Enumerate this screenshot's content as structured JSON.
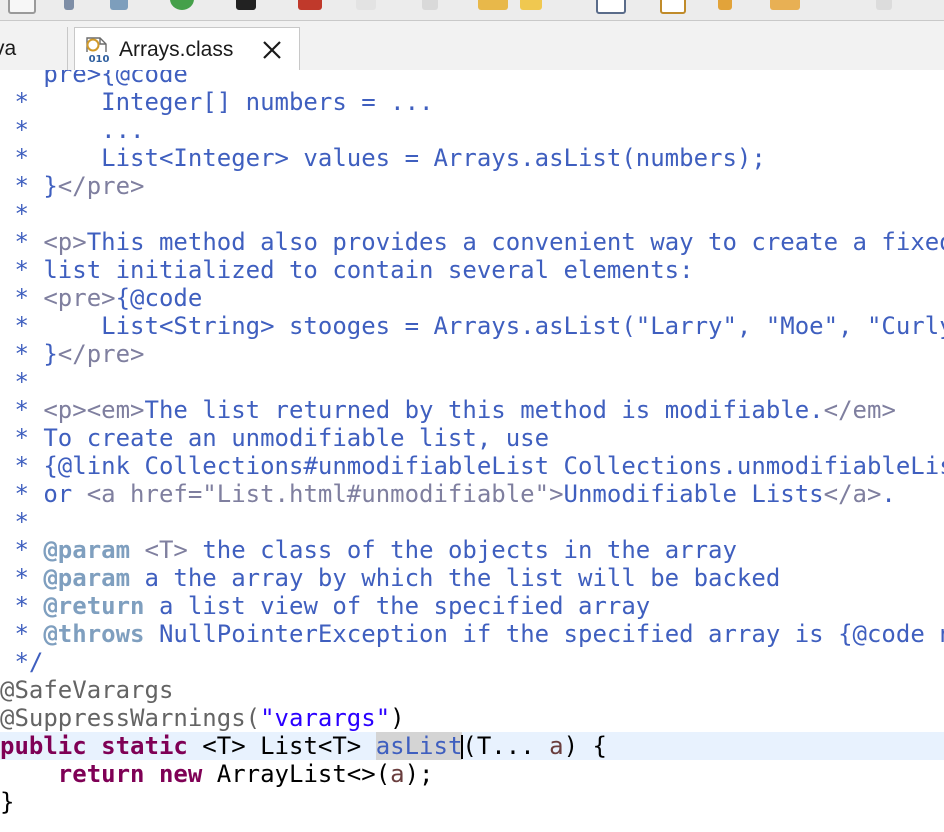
{
  "tabs": {
    "previous_label": "va",
    "active_label": "Arrays.class",
    "active_icon": "class-file-icon",
    "close_icon": "close-icon"
  },
  "toolbar": {
    "icons": [
      "toolbar-icon",
      "toolbar-icon",
      "toolbar-icon",
      "run-icon",
      "toolbar-icon",
      "toolbar-icon",
      "toolbar-icon",
      "toolbar-icon",
      "toolbar-icon",
      "toolbar-icon",
      "toolbar-icon",
      "toolbar-icon",
      "toolbar-icon",
      "toolbar-icon",
      "toolbar-icon"
    ]
  },
  "colors": {
    "javadoc": "#3f5fbf",
    "javadoc_tag": "#7f9fbf",
    "html_tag": "#7f7f9f",
    "keyword": "#7f0055",
    "string": "#2a00ff",
    "annotation": "#646464",
    "current_line": "#e8f2fe"
  },
  "code_lines": [
    [
      {
        "t": "   pre>{@code",
        "c": "c"
      }
    ],
    [
      {
        "t": " *     Integer[] numbers = ...",
        "c": "c"
      }
    ],
    [
      {
        "t": " *     ...",
        "c": "c"
      }
    ],
    [
      {
        "t": " *     List<Integer> values = Arrays.asList(numbers);",
        "c": "c"
      }
    ],
    [
      {
        "t": " * }",
        "c": "c"
      },
      {
        "t": "</pre>",
        "c": "tag"
      }
    ],
    [
      {
        "t": " *",
        "c": "c"
      }
    ],
    [
      {
        "t": " * ",
        "c": "c"
      },
      {
        "t": "<p>",
        "c": "tag"
      },
      {
        "t": "This method also provides a convenient way to create a fixed-size",
        "c": "c"
      }
    ],
    [
      {
        "t": " * list initialized to contain several elements:",
        "c": "c"
      }
    ],
    [
      {
        "t": " * ",
        "c": "c"
      },
      {
        "t": "<pre>",
        "c": "tag"
      },
      {
        "t": "{@code",
        "c": "c"
      }
    ],
    [
      {
        "t": " *     List<String> stooges = Arrays.asList(\"Larry\", \"Moe\", \"Curly\");",
        "c": "c"
      }
    ],
    [
      {
        "t": " * }",
        "c": "c"
      },
      {
        "t": "</pre>",
        "c": "tag"
      }
    ],
    [
      {
        "t": " *",
        "c": "c"
      }
    ],
    [
      {
        "t": " * ",
        "c": "c"
      },
      {
        "t": "<p><em>",
        "c": "tag"
      },
      {
        "t": "The list returned by this method is modifiable.",
        "c": "c"
      },
      {
        "t": "</em>",
        "c": "tag"
      }
    ],
    [
      {
        "t": " * To create an unmodifiable list, use",
        "c": "c"
      }
    ],
    [
      {
        "t": " * {@link Collections#unmodifiableList Collections.unmodifiableList}",
        "c": "c"
      }
    ],
    [
      {
        "t": " * or ",
        "c": "c"
      },
      {
        "t": "<a href=\"List.html#unmodifiable\">",
        "c": "tag"
      },
      {
        "t": "Unmodifiable Lists",
        "c": "c"
      },
      {
        "t": "</a>",
        "c": "tag"
      },
      {
        "t": ".",
        "c": "c"
      }
    ],
    [
      {
        "t": " *",
        "c": "c"
      }
    ],
    [
      {
        "t": " * ",
        "c": "c"
      },
      {
        "t": "@param",
        "c": "jdtag"
      },
      {
        "t": " ",
        "c": "c"
      },
      {
        "t": "<T>",
        "c": "tag"
      },
      {
        "t": " the class of the objects in the array",
        "c": "c"
      }
    ],
    [
      {
        "t": " * ",
        "c": "c"
      },
      {
        "t": "@param",
        "c": "jdtag"
      },
      {
        "t": " a the array by which the list will be backed",
        "c": "c"
      }
    ],
    [
      {
        "t": " * ",
        "c": "c"
      },
      {
        "t": "@return",
        "c": "jdtag"
      },
      {
        "t": " a list view of the specified array",
        "c": "c"
      }
    ],
    [
      {
        "t": " * ",
        "c": "c"
      },
      {
        "t": "@throws",
        "c": "jdtag"
      },
      {
        "t": " NullPointerException if the specified array is {@code null}",
        "c": "c"
      }
    ],
    [
      {
        "t": " */",
        "c": "c"
      }
    ],
    [
      {
        "t": "@SafeVarargs",
        "c": "ann"
      }
    ],
    [
      {
        "t": "@SuppressWarnings(",
        "c": "ann"
      },
      {
        "t": "\"varargs\"",
        "c": "str"
      },
      {
        "t": ")",
        "c": "plain"
      }
    ],
    [
      {
        "t": "public",
        "c": "kw"
      },
      {
        "t": " ",
        "c": "plain"
      },
      {
        "t": "static",
        "c": "kw"
      },
      {
        "t": " <T> List<T> ",
        "c": "plain"
      },
      {
        "t": "asList",
        "c": "sel"
      },
      {
        "t": "",
        "c": "caret"
      },
      {
        "t": "(T... ",
        "c": "plain"
      },
      {
        "t": "a",
        "c": "param"
      },
      {
        "t": ") {",
        "c": "plain"
      }
    ],
    [
      {
        "t": "    ",
        "c": "plain"
      },
      {
        "t": "return",
        "c": "kw"
      },
      {
        "t": " ",
        "c": "plain"
      },
      {
        "t": "new",
        "c": "kw"
      },
      {
        "t": " ArrayList<>(",
        "c": "plain"
      },
      {
        "t": "a",
        "c": "param"
      },
      {
        "t": ");",
        "c": "plain"
      }
    ],
    [
      {
        "t": "}",
        "c": "plain"
      }
    ]
  ],
  "current_line_index": 24
}
